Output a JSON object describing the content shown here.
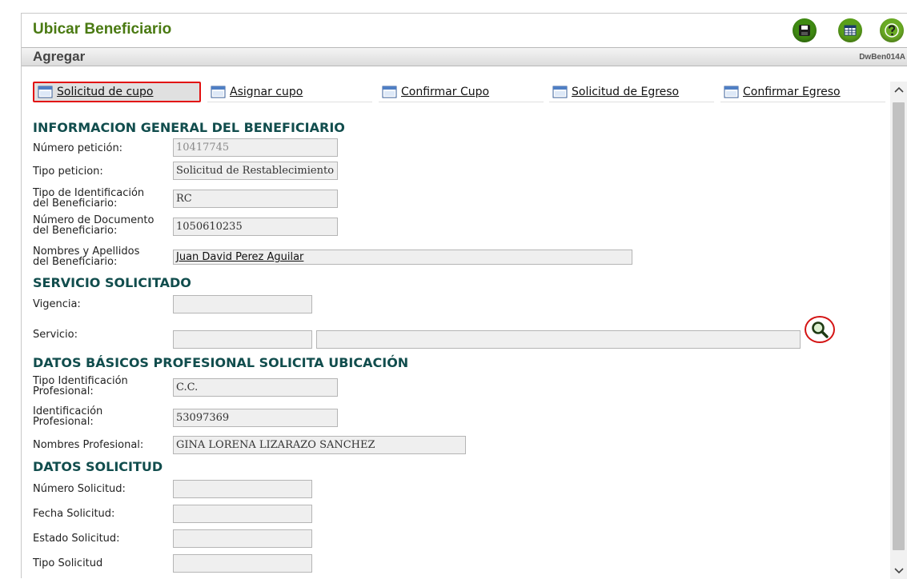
{
  "app": {
    "title": "Ubicar Beneficiario",
    "subtitle": "Agregar",
    "form_code": "DwBen014A",
    "toolbar_icons": [
      "save-icon",
      "grid-icon",
      "help-icon"
    ],
    "accent": "#4a7a12"
  },
  "tabs": [
    {
      "label": "Solicitud de cupo",
      "active": true
    },
    {
      "label": "Asignar cupo",
      "active": false
    },
    {
      "label": "Confirmar Cupo",
      "active": false
    },
    {
      "label": "Solicitud de Egreso",
      "active": false
    },
    {
      "label": "Confirmar Egreso",
      "active": false
    }
  ],
  "sections": {
    "general": "INFORMACION GENERAL DEL BENEFICIARIO",
    "servicio": "SERVICIO SOLICITADO",
    "profesional": "DATOS BÁSICOS PROFESIONAL SOLICITA UBICACIÓN",
    "solicitud": "DATOS SOLICITUD"
  },
  "general": {
    "numero_peticion": {
      "label": "Número petición:",
      "value": "10417745"
    },
    "tipo_peticion": {
      "label": "Tipo peticion:",
      "value": "Solicitud de Restablecimiento"
    },
    "tipo_identificacion": {
      "label_1": "Tipo de Identificación",
      "label_2": "del Beneficiario:",
      "value": "RC"
    },
    "numero_documento": {
      "label_1": "Número de Documento",
      "label_2": "del Beneficiario:",
      "value": "1050610235"
    },
    "nombres": {
      "label_1": "Nombres y Apellidos",
      "label_2": "del Beneficiario:",
      "value": "Juan David Perez Aguilar"
    }
  },
  "servicio": {
    "vigencia": {
      "label": "Vigencia:",
      "value": ""
    },
    "servicio": {
      "label": "Servicio:",
      "code": "",
      "description": ""
    }
  },
  "profesional": {
    "tipo_identificacion": {
      "label_1": "Tipo Identificación",
      "label_2": "Profesional:",
      "value": "C.C."
    },
    "identificacion": {
      "label_1": "Identificación",
      "label_2": "Profesional:",
      "value": "53097369"
    },
    "nombres": {
      "label": "Nombres Profesional:",
      "value": "GINA LORENA LIZARAZO SANCHEZ"
    }
  },
  "solicitud": {
    "numero": {
      "label": "Número Solicitud:",
      "value": ""
    },
    "fecha": {
      "label": "Fecha Solicitud:",
      "value": ""
    },
    "estado": {
      "label": "Estado Solicitud:",
      "value": ""
    },
    "tipo": {
      "label": "Tipo Solicitud",
      "value": ""
    }
  }
}
